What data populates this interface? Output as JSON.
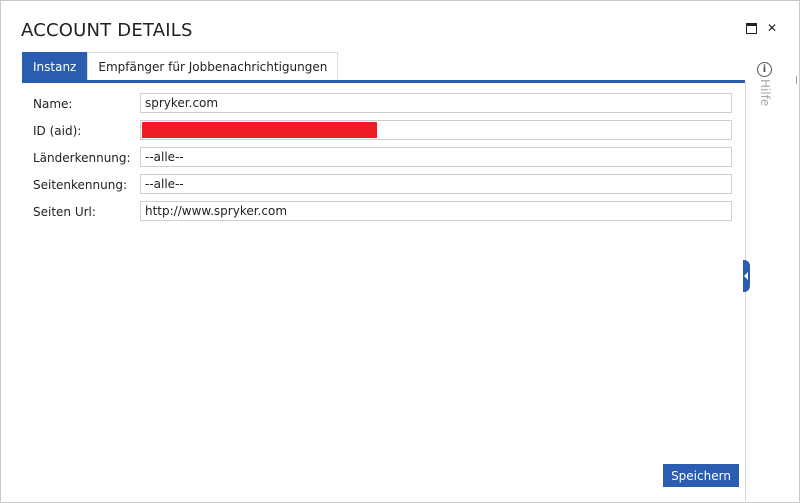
{
  "dialog": {
    "title": "ACCOUNT DETAILS",
    "tabs": [
      {
        "label": "Instanz",
        "active": true
      },
      {
        "label": "Empfänger für Jobbenachrichtigungen",
        "active": false
      }
    ],
    "fields": [
      {
        "label": "Name:",
        "value": "spryker.com"
      },
      {
        "label": "ID (aid):",
        "value": "",
        "redacted": true
      },
      {
        "label": "Länderkennung:",
        "value": "--alle--"
      },
      {
        "label": "Seitenkennung:",
        "value": "--alle--"
      },
      {
        "label": "Seiten Url:",
        "value": "http://www.spryker.com"
      }
    ],
    "save_label": "Speichern"
  },
  "side_panel": {
    "help_label": "Hilfe",
    "info_icon": "i"
  },
  "colors": {
    "accent": "#2a5db0",
    "redaction": "#ee1c25"
  }
}
